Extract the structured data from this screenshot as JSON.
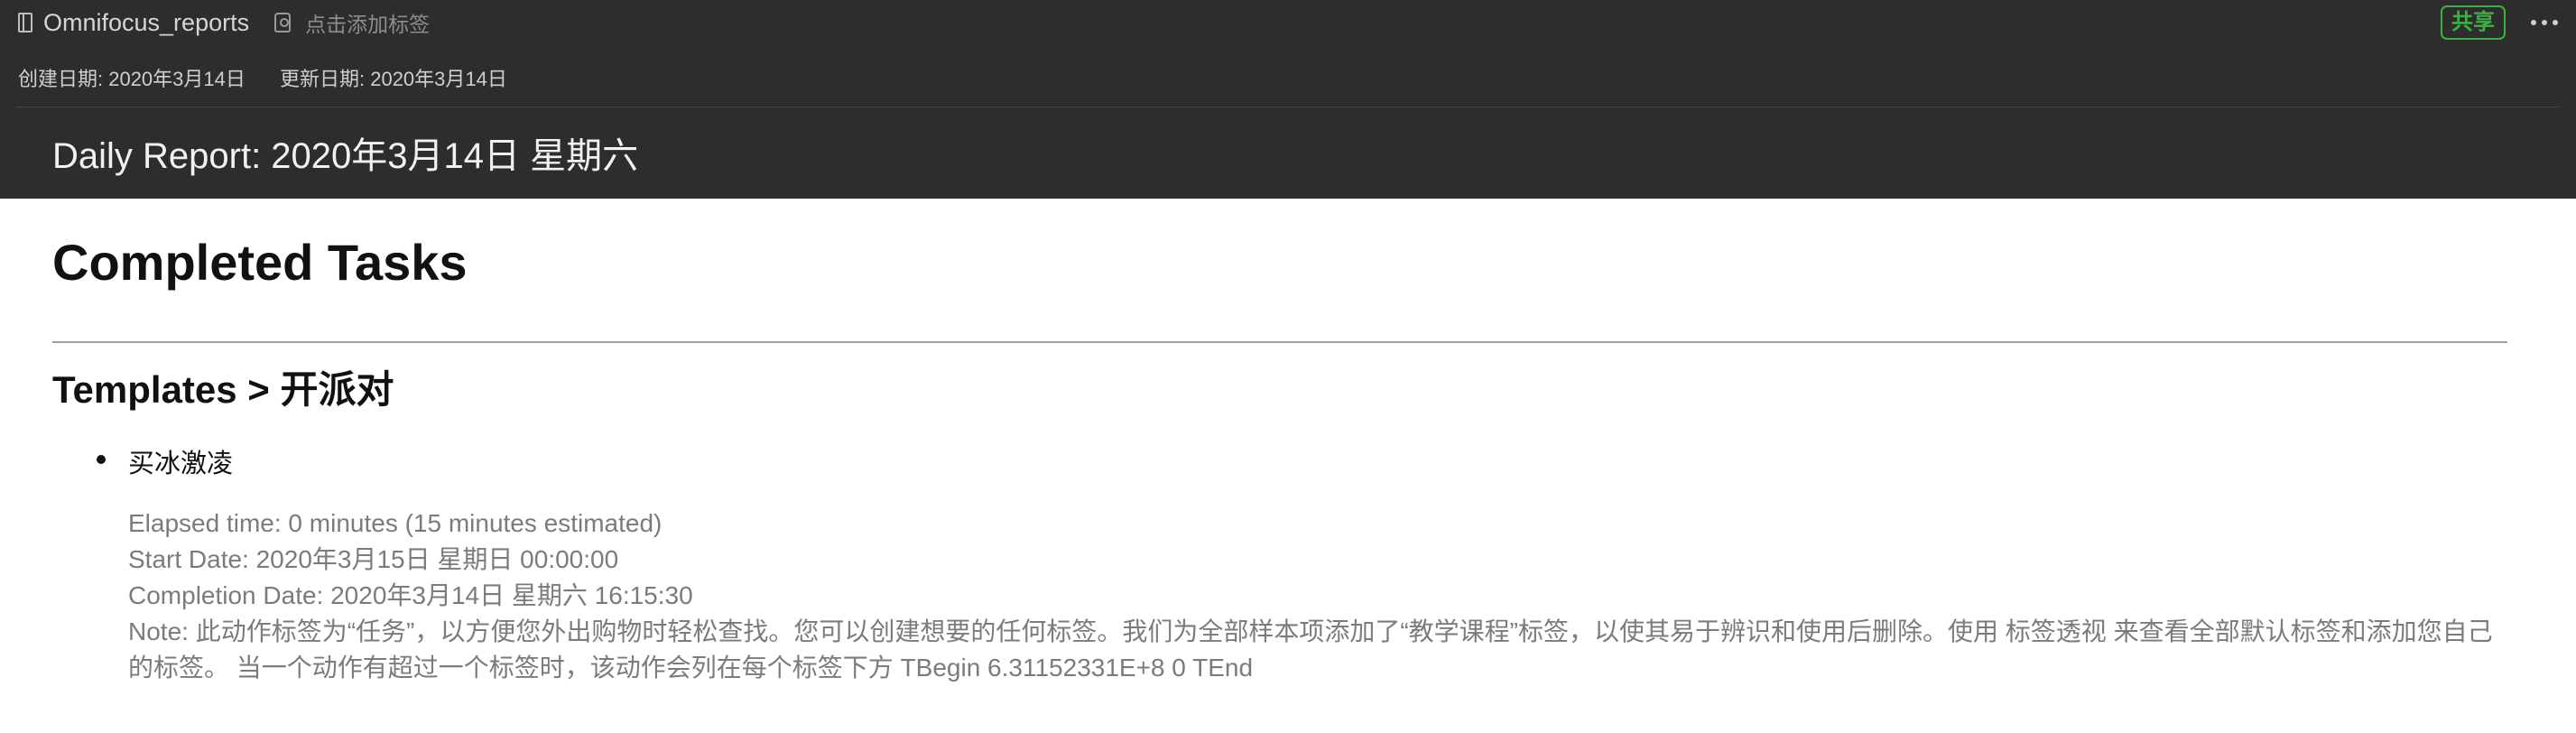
{
  "header": {
    "notebook_name": "Omnifocus_reports",
    "tag_placeholder": "点击添加标签",
    "share_label": "共享",
    "created": "创建日期: 2020年3月14日",
    "updated": "更新日期: 2020年3月14日",
    "report_title": "Daily Report: 2020年3月14日 星期六"
  },
  "content": {
    "heading": "Completed Tasks",
    "section": "Templates > 开派对",
    "tasks": [
      {
        "title": "买冰激凌",
        "elapsed": "Elapsed time: 0 minutes (15 minutes estimated)",
        "start": "Start Date: 2020年3月15日 星期日 00:00:00",
        "completion": "Completion Date: 2020年3月14日 星期六 16:15:30",
        "note": "Note: 此动作标签为“任务”，以方便您外出购物时轻松查找。您可以创建想要的任何标签。我们为全部样本项添加了“教学课程”标签，以使其易于辨识和使用后删除。使用 标签透视 来查看全部默认标签和添加您自己的标签。 当一个动作有超过一个标签时，该动作会列在每个标签下方 TBegin 6.31152331E+8 0 TEnd"
      }
    ]
  }
}
